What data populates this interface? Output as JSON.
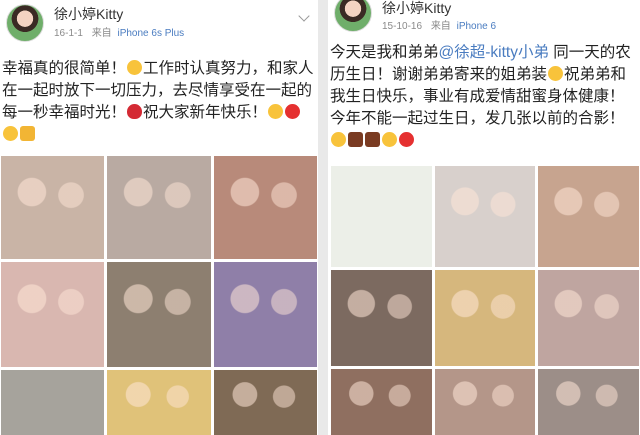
{
  "posts": [
    {
      "username": "徐小婷Kitty",
      "date": "16-1-1",
      "source_prefix": "来自",
      "source": "iPhone 6s Plus",
      "text_segments": [
        {
          "t": "幸福真的很简单！"
        },
        {
          "emoji": "smile-emoji"
        },
        {
          "t": "工作时认真努力，和家人在一起时放下一切压力，去尽情享受在一起的每一秒幸福时光！"
        },
        {
          "emoji": "strawberry-emoji"
        },
        {
          "t": "祝大家新年快乐！"
        },
        {
          "emoji": "smile-emoji"
        },
        {
          "emoji": "heart-emoji"
        },
        {
          "emoji": "smile-emoji"
        },
        {
          "emoji": "cheers-emoji"
        }
      ],
      "photos": [
        {
          "name": "photo-family-group",
          "color": "#c9b4a6"
        },
        {
          "name": "photo-family-gathering",
          "color": "#b9aaa2"
        },
        {
          "name": "photo-strawberry-picking",
          "color": "#b88a7a"
        },
        {
          "name": "photo-sisters-selfie",
          "color": "#d9b7b0"
        },
        {
          "name": "photo-family-dinner",
          "color": "#8d7f70"
        },
        {
          "name": "photo-flowers-group",
          "color": "#8f7fa8"
        },
        {
          "name": "photo-living-room",
          "color": "#a6a39c"
        },
        {
          "name": "photo-cake",
          "color": "#e0c279"
        },
        {
          "name": "photo-dinner-table",
          "color": "#7f6a55"
        }
      ]
    },
    {
      "username": "徐小婷Kitty",
      "date": "15-10-16",
      "source_prefix": "来自",
      "source": "iPhone 6",
      "text_segments": [
        {
          "t": "今天是我和弟弟"
        },
        {
          "mention": "@徐超-kitty小弟"
        },
        {
          "t": " 同一天的农历生日！谢谢弟弟寄来的姐弟装"
        },
        {
          "emoji": "smile-emoji"
        },
        {
          "t": "祝弟弟和我生日快乐，事业有成爱情甜蜜身体健康！今年不能一起过生日，发几张以前的合影！"
        },
        {
          "emoji": "smile-emoji"
        },
        {
          "emoji": "cake-emoji"
        },
        {
          "emoji": "cake-emoji"
        },
        {
          "emoji": "smile-emoji"
        },
        {
          "emoji": "heart-emoji"
        }
      ],
      "photos": [
        {
          "name": "photo-chat-screenshot",
          "color": "#ecefe8"
        },
        {
          "name": "photo-birthday-cake-woman",
          "color": "#d8d0cc"
        },
        {
          "name": "photo-siblings-portrait",
          "color": "#c7a48f"
        },
        {
          "name": "photo-siblings-closeup",
          "color": "#7c6a60"
        },
        {
          "name": "photo-crepe-cake",
          "color": "#d6b77d"
        },
        {
          "name": "photo-siblings-selfie",
          "color": "#bfa5a0"
        },
        {
          "name": "photo-siblings-crowns",
          "color": "#8f6f60"
        },
        {
          "name": "photo-siblings-party",
          "color": "#b49689"
        },
        {
          "name": "photo-old-family-photo",
          "color": "#9c8e88"
        }
      ]
    }
  ]
}
